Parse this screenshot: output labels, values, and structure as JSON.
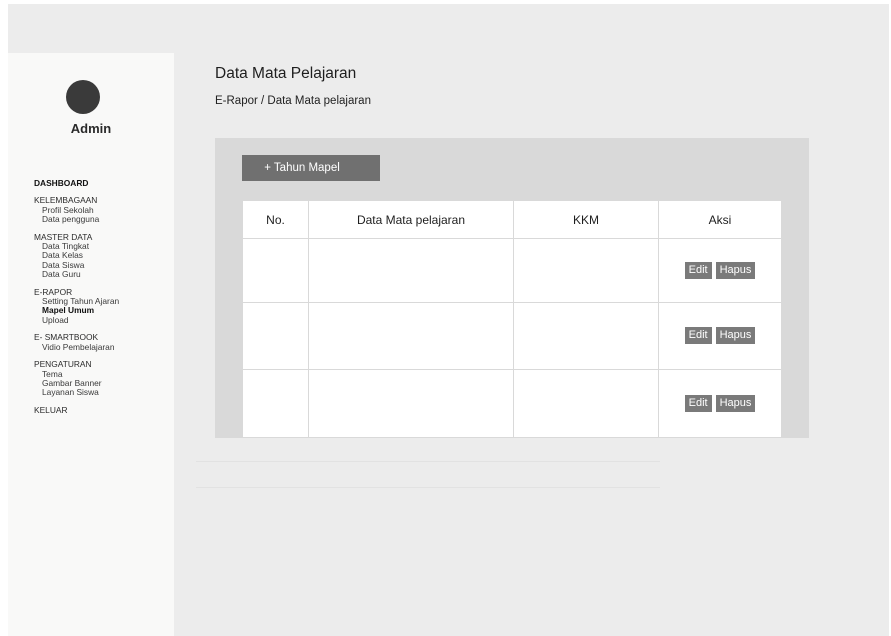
{
  "sidebar": {
    "admin_name": "Admin",
    "dashboard": "DASHBOARD",
    "kelembagaan": {
      "label": "KELEMBAGAAN",
      "items": [
        "Profil Sekolah",
        "Data pengguna"
      ]
    },
    "master_data": {
      "label": "MASTER DATA",
      "items": [
        "Data Tingkat",
        "Data Kelas",
        "Data Siswa",
        "Data Guru"
      ]
    },
    "erapor": {
      "label": "E-RAPOR",
      "items": [
        "Setting Tahun Ajaran",
        "Mapel Umum",
        "Upload"
      ]
    },
    "smartbook": {
      "label": "E- SMARTBOOK",
      "items": [
        "Vidio Pembelajaran"
      ]
    },
    "pengaturan": {
      "label": "PENGATURAN",
      "items": [
        "Tema",
        "Gambar Banner",
        "Layanan Siswa"
      ]
    },
    "keluar": "KELUAR"
  },
  "header": {
    "title": "Data Mata Pelajaran",
    "breadcrumb": "E-Rapor / Data Mata pelajaran"
  },
  "toolbar": {
    "add_label": "+ Tahun Mapel"
  },
  "table": {
    "columns": [
      "No.",
      "Data Mata pelajaran",
      "KKM",
      "Aksi"
    ],
    "rows": [
      {
        "no": "",
        "mapel": "",
        "kkm": ""
      },
      {
        "no": "",
        "mapel": "",
        "kkm": ""
      },
      {
        "no": "",
        "mapel": "",
        "kkm": ""
      }
    ],
    "edit_label": "Edit",
    "delete_label": "Hapus"
  }
}
